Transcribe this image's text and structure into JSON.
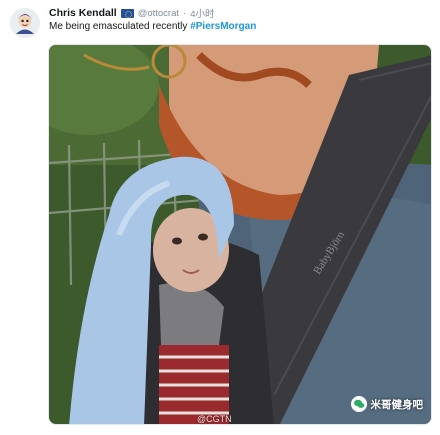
{
  "tweet": {
    "author": "Chris Kendall",
    "handle": "@ottocrat",
    "separator": "·",
    "time": "4小时",
    "text_prefix": "Me being emasculated recently ",
    "hashtag": "#PiersMorgan",
    "flag_icon": "eu-flag-icon",
    "avatar_icon": "cartoon-avatar-icon"
  },
  "photo": {
    "carrier_label": "BabyBjörn",
    "watermark": "@CGTN",
    "badge_text": "米哥健身吧",
    "badge_icon": "wechat-icon"
  },
  "colors": {
    "hashtag": "#1b95e0",
    "meta": "#7e8b96",
    "blanket": "#a9c6e6",
    "beard": "#c1622a",
    "shirt": "#4f6478"
  }
}
